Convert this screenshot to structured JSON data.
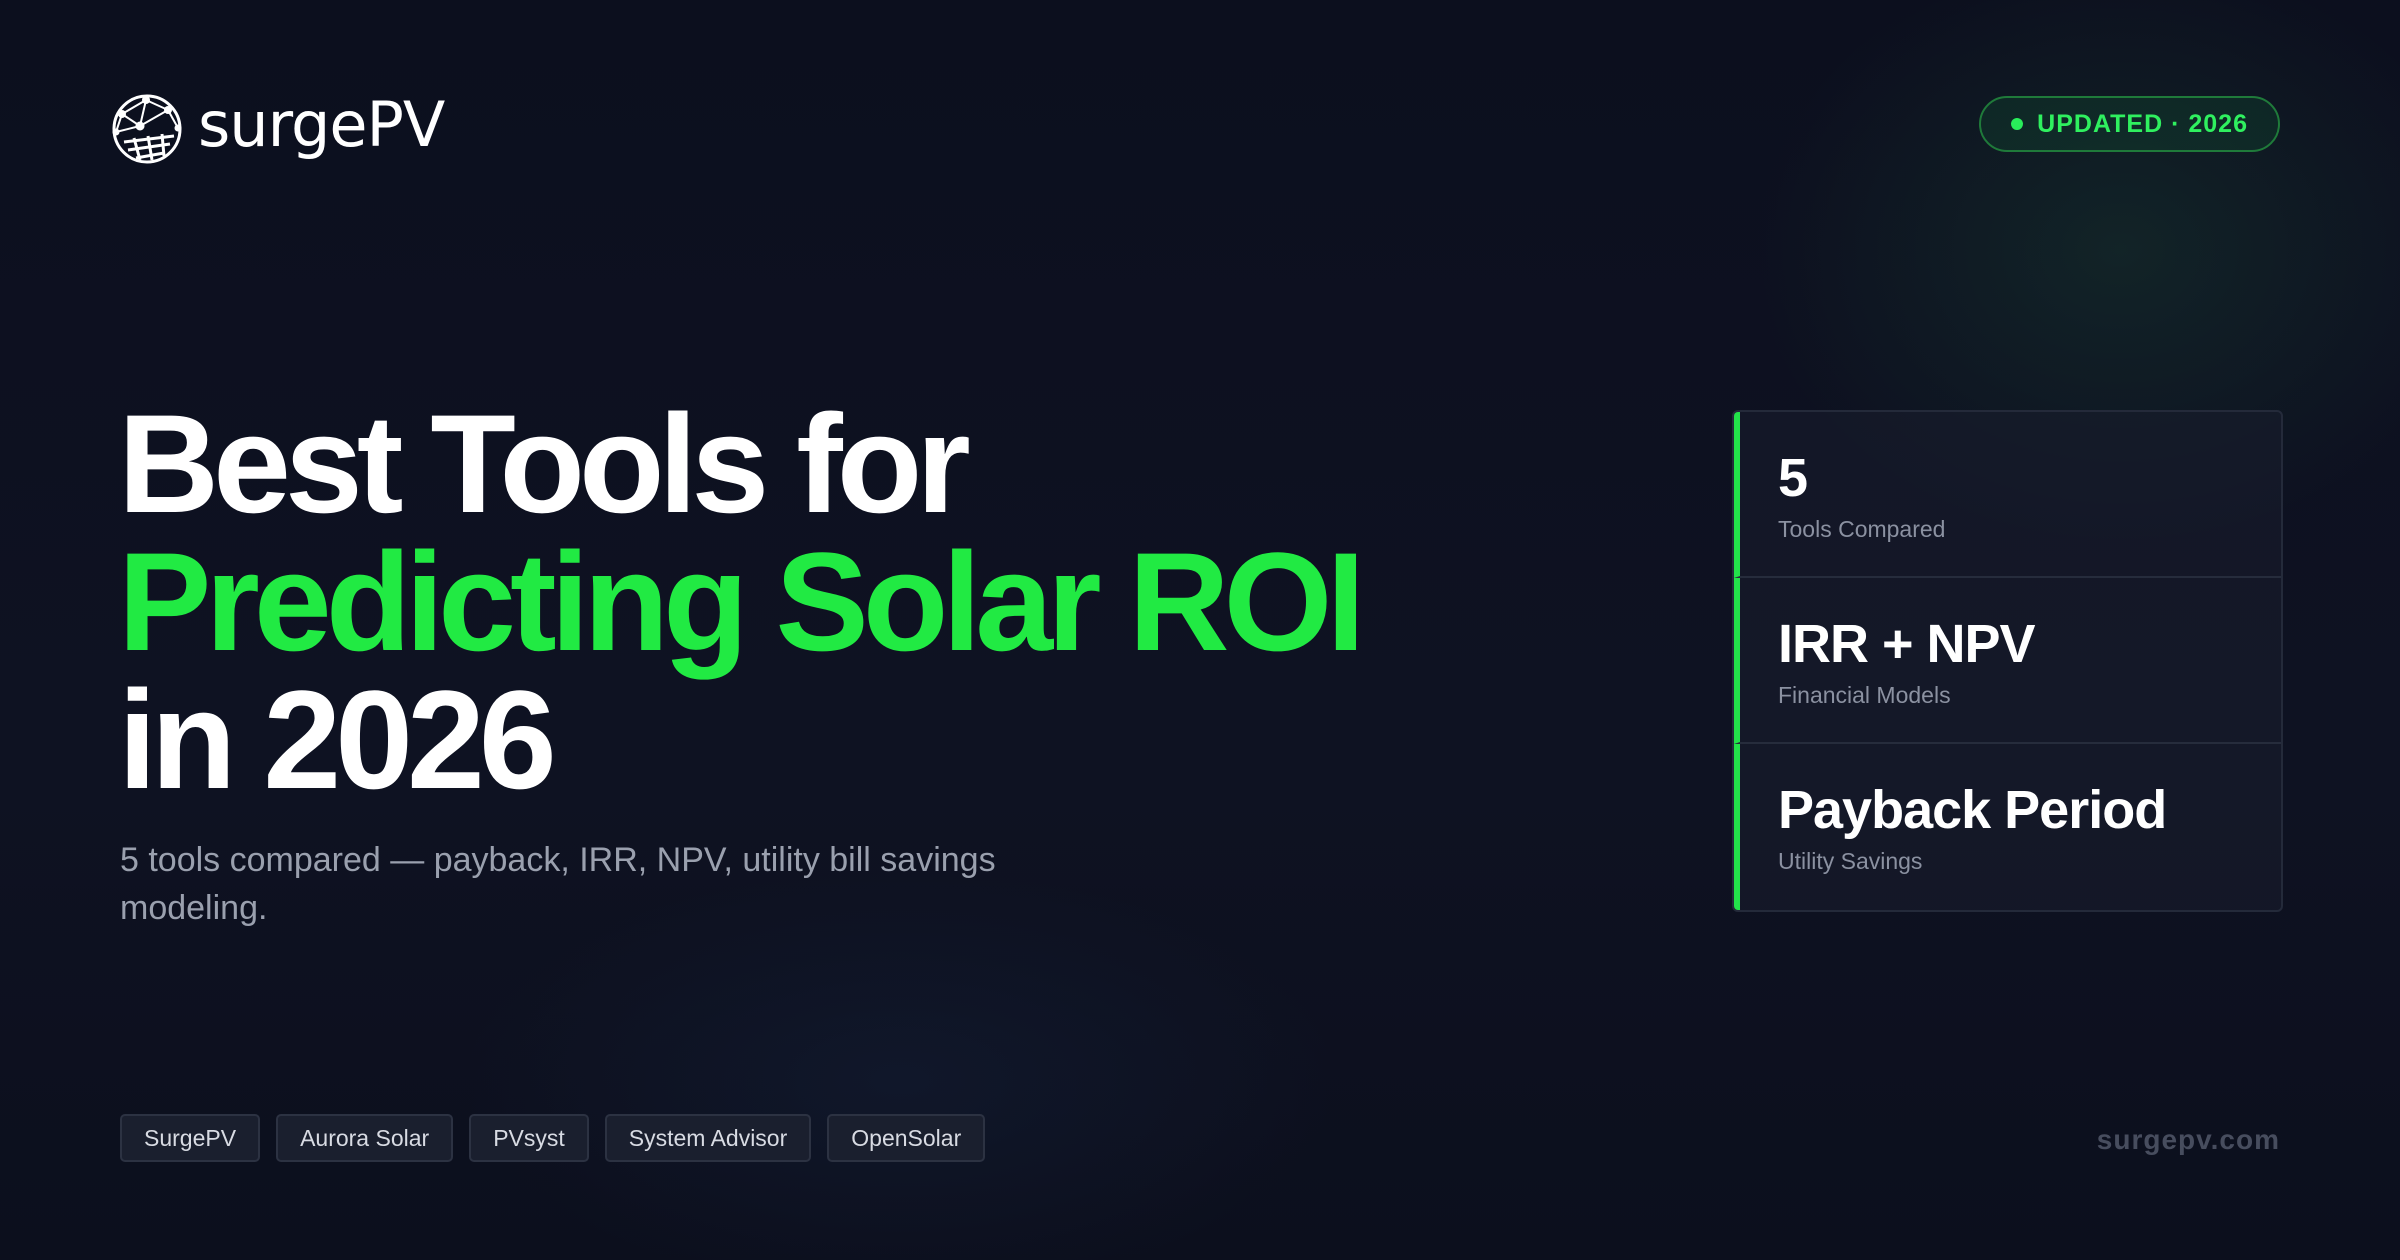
{
  "brand": {
    "logo_text": "surgePV",
    "logo_icon": "globe-grid-icon"
  },
  "badge": {
    "label": "UPDATED · 2026",
    "dot_color": "#29ee5a"
  },
  "headline": {
    "line1": "Best Tools for",
    "line2": "Predicting Solar ROI",
    "line3": "in 2026",
    "accent_color": "#21ea43"
  },
  "subtitle": "5 tools compared — payback, IRR, NPV, utility bill savings modeling.",
  "stats": [
    {
      "value": "5",
      "label": "Tools Compared"
    },
    {
      "value": "IRR + NPV",
      "label": "Financial Models"
    },
    {
      "value": "Payback Period",
      "label": "Utility Savings"
    }
  ],
  "tags": [
    "SurgePV",
    "Aurora Solar",
    "PVsyst",
    "System Advisor",
    "OpenSolar"
  ],
  "footer": {
    "site": "surgepv.com"
  }
}
